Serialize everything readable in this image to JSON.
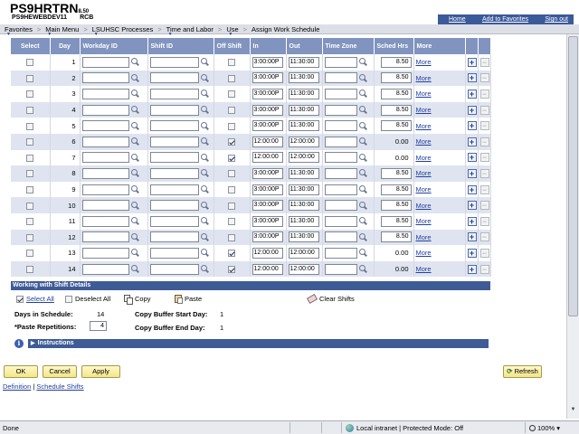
{
  "header": {
    "app_title": "PS9HRTRN",
    "version": "8.50",
    "database": "PS9HEWEBDEV11",
    "user": "RCB",
    "links": [
      "Home",
      "Add to Favorites",
      "Sign out"
    ]
  },
  "nav": {
    "items": [
      "Favorites",
      "Main Menu",
      "LSUHSC Processes",
      "Time and Labor",
      "Use",
      "Assign Work Schedule"
    ],
    "separator": ">"
  },
  "grid": {
    "columns": [
      "Select",
      "Day",
      "Workday ID",
      "Shift ID",
      "Off Shift",
      "In",
      "Out",
      "Time Zone",
      "Sched Hrs",
      "More",
      "",
      ""
    ],
    "more_label": "More",
    "rows": [
      {
        "day": "1",
        "off": false,
        "in": "3:00:00P",
        "out": "11:30:00",
        "hrs": "8.50"
      },
      {
        "day": "2",
        "off": false,
        "in": "3:00:00P",
        "out": "11:30:00",
        "hrs": "8.50"
      },
      {
        "day": "3",
        "off": false,
        "in": "3:00:00P",
        "out": "11:30:00",
        "hrs": "8.50"
      },
      {
        "day": "4",
        "off": false,
        "in": "3:00:00P",
        "out": "11:30:00",
        "hrs": "8.50"
      },
      {
        "day": "5",
        "off": false,
        "in": "3:00:00P",
        "out": "11:30:00",
        "hrs": "8.50"
      },
      {
        "day": "6",
        "off": true,
        "in": "12:00:00",
        "out": "12:00:00",
        "hrs": "0.00"
      },
      {
        "day": "7",
        "off": true,
        "in": "12:00:00",
        "out": "12:00:00",
        "hrs": "0.00"
      },
      {
        "day": "8",
        "off": false,
        "in": "3:00:00P",
        "out": "11:30:00",
        "hrs": "8.50"
      },
      {
        "day": "9",
        "off": false,
        "in": "3:00:00P",
        "out": "11:30:00",
        "hrs": "8.50"
      },
      {
        "day": "10",
        "off": false,
        "in": "3:00:00P",
        "out": "11:30:00",
        "hrs": "8.50"
      },
      {
        "day": "11",
        "off": false,
        "in": "3:00:00P",
        "out": "11:30:00",
        "hrs": "8.50"
      },
      {
        "day": "12",
        "off": false,
        "in": "3:00:00P",
        "out": "11:30:00",
        "hrs": "8.50"
      },
      {
        "day": "13",
        "off": true,
        "in": "12:00:00",
        "out": "12:00:00",
        "hrs": "0.00"
      },
      {
        "day": "14",
        "off": true,
        "in": "12:00:00",
        "out": "12:00:00",
        "hrs": "0.00"
      }
    ]
  },
  "working": {
    "title": "Working with Shift Details",
    "select_all": "Select All",
    "deselect_all": "Deselect All",
    "copy": "Copy",
    "paste": "Paste",
    "clear_shifts": "Clear Shifts",
    "days_label": "Days in Schedule:",
    "days_value": "14",
    "paste_label": "*Paste Repetitions:",
    "paste_value": "4",
    "buffer_start_label": "Copy Buffer Start Day:",
    "buffer_start_value": "1",
    "buffer_end_label": "Copy Buffer End Day:",
    "buffer_end_value": "1",
    "instructions": "Instructions"
  },
  "buttons": {
    "ok": "OK",
    "cancel": "Cancel",
    "apply": "Apply",
    "refresh": "Refresh"
  },
  "footer": {
    "link1": "Definition",
    "sep": "|",
    "link2": "Schedule Shifts"
  },
  "status": {
    "left": "Done",
    "zone": "Local intranet | Protected Mode: Off",
    "zoom": "100%"
  }
}
